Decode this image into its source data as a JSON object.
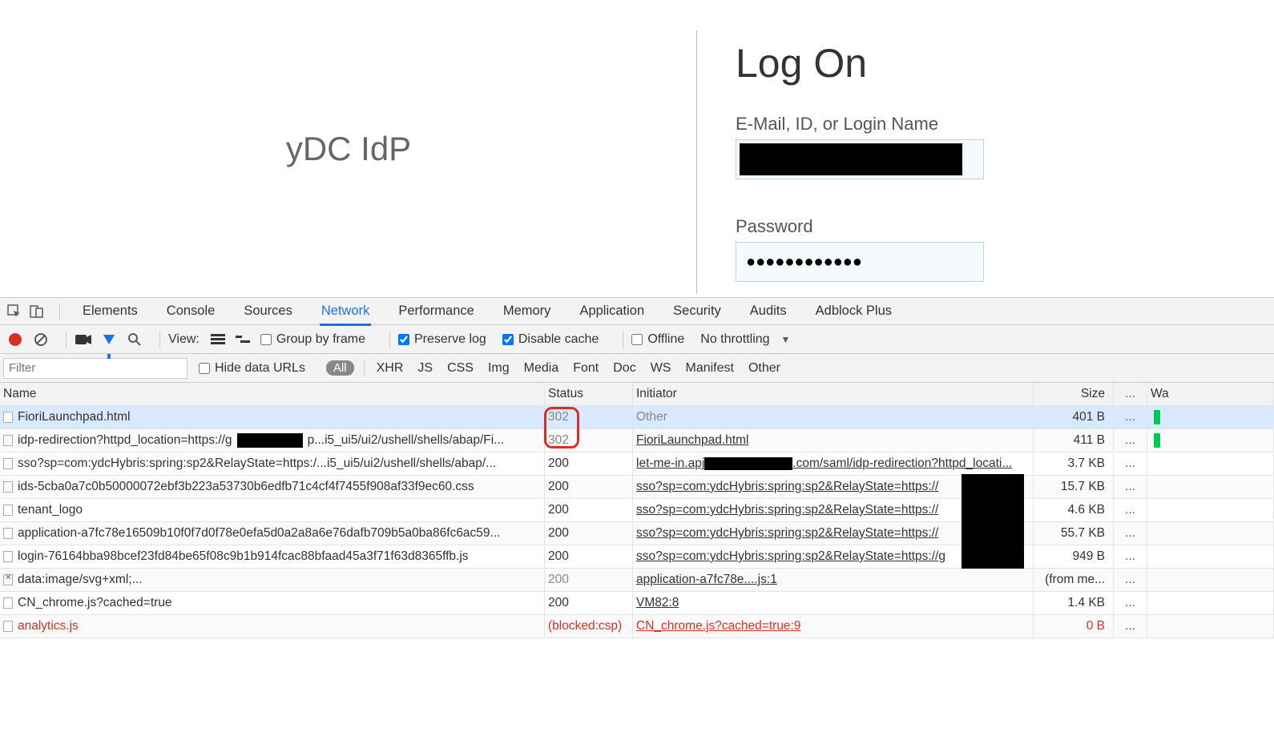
{
  "login": {
    "brand": "yDC IdP",
    "title": "Log On",
    "email_label": "E-Mail, ID, or Login Name",
    "password_label": "Password",
    "password_value": "●●●●●●●●●●●●"
  },
  "tabs": {
    "items": [
      "Elements",
      "Console",
      "Sources",
      "Network",
      "Performance",
      "Memory",
      "Application",
      "Security",
      "Audits",
      "Adblock Plus"
    ],
    "active": "Network"
  },
  "netbar": {
    "view_label": "View:",
    "group_label": "Group by frame",
    "preserve_label": "Preserve log",
    "disable_cache_label": "Disable cache",
    "offline_label": "Offline",
    "throttling_label": "No throttling"
  },
  "filterbar": {
    "filter_placeholder": "Filter",
    "hide_urls_label": "Hide data URLs",
    "pill": "All",
    "types": [
      "XHR",
      "JS",
      "CSS",
      "Img",
      "Media",
      "Font",
      "Doc",
      "WS",
      "Manifest",
      "Other"
    ]
  },
  "columns": {
    "name": "Name",
    "status": "Status",
    "initiator": "Initiator",
    "size": "Size",
    "dots": "...",
    "waterfall": "Wa"
  },
  "rows": [
    {
      "selected": true,
      "name": "FioriLaunchpad.html",
      "status": "302",
      "status_gray": true,
      "initiator": "Other",
      "init_link": false,
      "size": "401 B",
      "wf": true
    },
    {
      "name": "idp-redirection?httpd_location=https://g",
      "name_suffix": "p...i5_ui5/ui2/ushell/shells/abap/Fi...",
      "name_redact": true,
      "status": "302",
      "status_gray": true,
      "initiator": "FioriLaunchpad.html",
      "init_link": true,
      "size": "411 B",
      "wf": true
    },
    {
      "name": "sso?sp=com:ydcHybris:spring:sp2&RelayState=https:/...i5_ui5/ui2/ushell/shells/abap/...",
      "status": "200",
      "initiator": "let-me-in.apj",
      "init_suffix": ".com/saml/idp-redirection?httpd_locati...",
      "init_redact": true,
      "init_link": true,
      "size": "3.7 KB"
    },
    {
      "name": "ids-5cba0a7c0b50000072ebf3b223a53730b6edfb71c4cf4f7455f908af33f9ec60.css",
      "status": "200",
      "initiator": "sso?sp=com:ydcHybris:spring:sp2&RelayState=https://",
      "init_tail_redact": true,
      "init_link": true,
      "size": "15.7 KB"
    },
    {
      "name": "tenant_logo",
      "status": "200",
      "initiator": "sso?sp=com:ydcHybris:spring:sp2&RelayState=https://",
      "init_tail_redact": true,
      "init_link": true,
      "size": "4.6 KB"
    },
    {
      "name": "application-a7fc78e16509b10f0f7d0f78e0efa5d0a2a8a6e76dafb709b5a0ba86fc6ac59...",
      "status": "200",
      "initiator": "sso?sp=com:ydcHybris:spring:sp2&RelayState=https://",
      "init_tail_redact": true,
      "init_link": true,
      "size": "55.7 KB"
    },
    {
      "name": "login-76164bba98bcef23fd84be65f08c9b1b914fcac88bfaad45a3f71f63d8365ffb.js",
      "status": "200",
      "initiator": "sso?sp=com:ydcHybris:spring:sp2&RelayState=https://g",
      "init_tail_redact": true,
      "init_link": true,
      "size": "949 B"
    },
    {
      "icon": "err",
      "name": "data:image/svg+xml;...",
      "status": "200",
      "status_gray": true,
      "initiator": "application-a7fc78e....js:1",
      "init_link": true,
      "size": "(from me..."
    },
    {
      "name": "CN_chrome.js?cached=true",
      "status": "200",
      "initiator": "VM82:8",
      "init_link": true,
      "size": "1.4 KB"
    },
    {
      "blocked": true,
      "name": "analytics.js",
      "status": "(blocked:csp)",
      "initiator": "CN_chrome.js?cached=true:9",
      "init_link": true,
      "size": "0 B"
    }
  ]
}
